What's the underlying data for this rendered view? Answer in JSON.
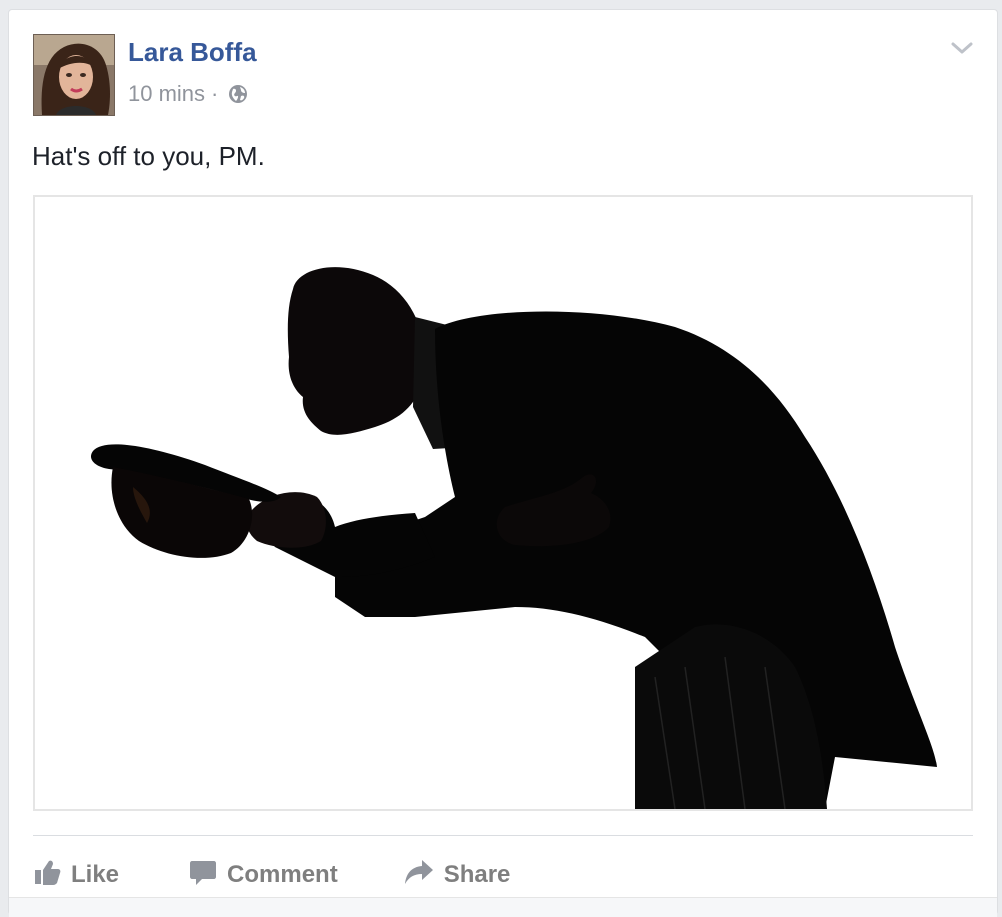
{
  "post": {
    "author": "Lara Boffa",
    "time": "10 mins",
    "separator": "·",
    "privacy_icon": "globe-icon",
    "text": "Hat's off to you, PM.",
    "menu_icon": "chevron-down-icon",
    "photo_description_icon": "bowing-man-silhouette"
  },
  "actions": {
    "like_label": "Like",
    "comment_label": "Comment",
    "share_label": "Share"
  },
  "colors": {
    "author_link": "#365899",
    "meta_text": "#90949c",
    "action_text": "#7f7f7f",
    "card_bg": "#ffffff",
    "page_bg": "#e9ebee"
  }
}
